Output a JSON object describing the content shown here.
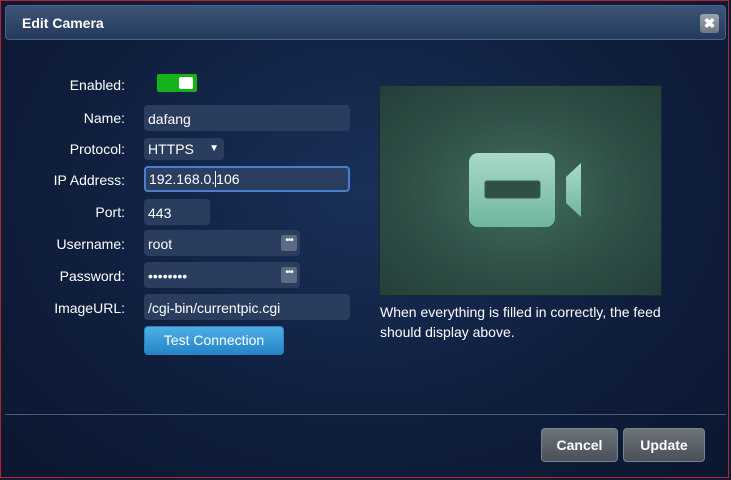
{
  "dialog": {
    "title": "Edit Camera",
    "close_glyph": "✖"
  },
  "form": {
    "enabled": {
      "label": "Enabled:",
      "value": true
    },
    "name": {
      "label": "Name:",
      "value": "dafang"
    },
    "protocol": {
      "label": "Protocol:",
      "value": "HTTPS"
    },
    "ip": {
      "label": "IP Address:",
      "value_before_caret": "192.168.0.",
      "value_after_caret": "106"
    },
    "port": {
      "label": "Port:",
      "value": "443"
    },
    "username": {
      "label": "Username:",
      "value": "root"
    },
    "password": {
      "label": "Password:",
      "value": "••••••••"
    },
    "image_url": {
      "label": "ImageURL:",
      "value": "/cgi-bin/currentpic.cgi"
    },
    "test_button": "Test Connection"
  },
  "preview": {
    "icon": "video-camera-icon",
    "help_text": "When everything is filled in correctly, the feed should display above."
  },
  "footer": {
    "cancel_label": "Cancel",
    "update_label": "Update"
  },
  "colors": {
    "toggle_on": "#15b319",
    "accent_button": "#2585c7",
    "dialog_border": "#c0202a"
  }
}
